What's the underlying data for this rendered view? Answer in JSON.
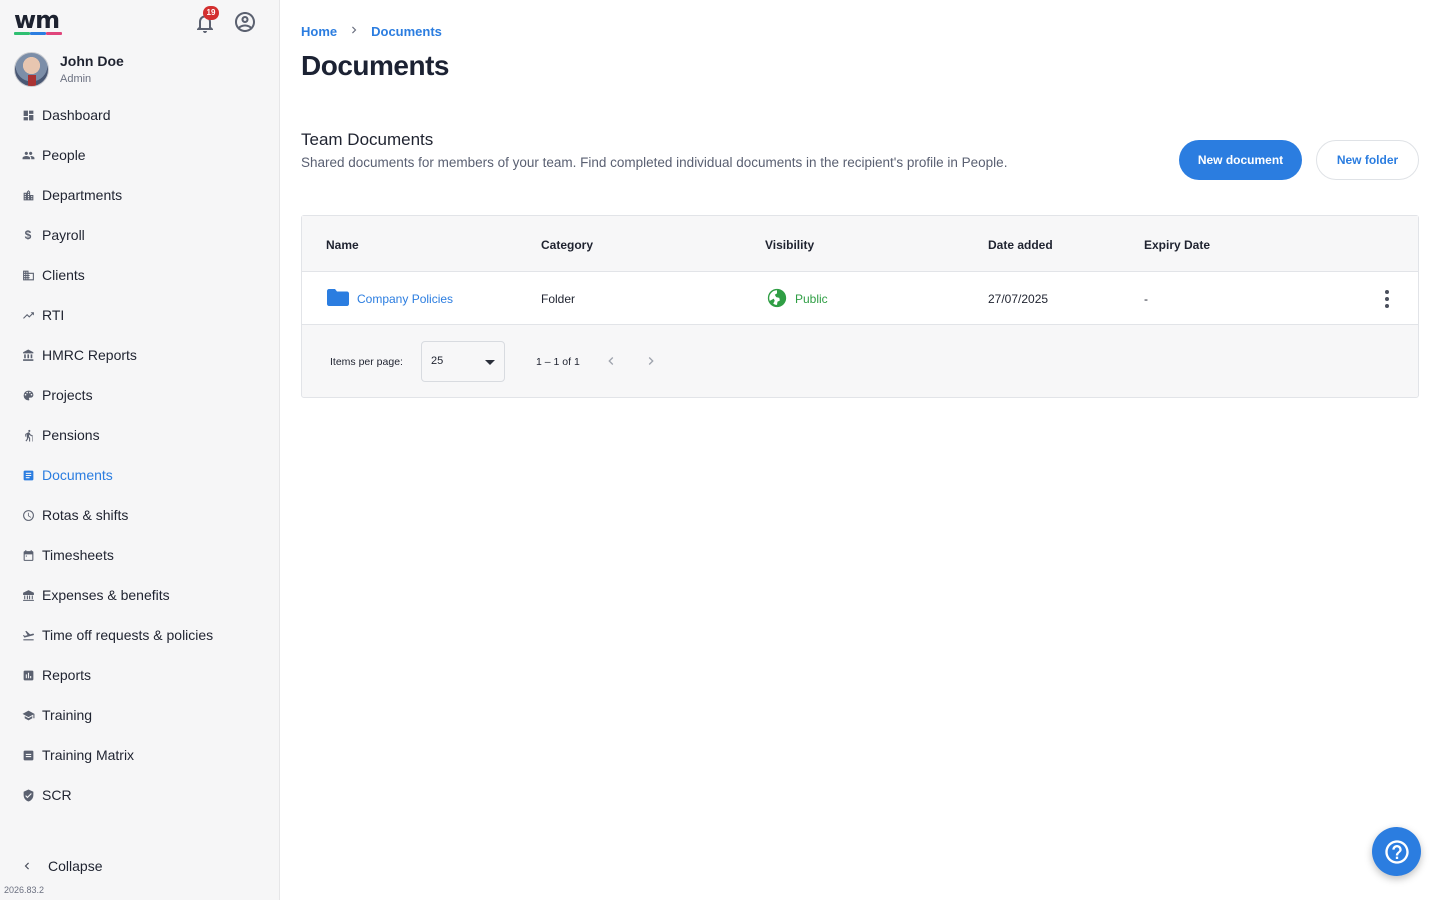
{
  "app": {
    "logo_text": "wm",
    "logo_colors": [
      "#2fbf71",
      "#2b7de0",
      "#e0457b"
    ],
    "notification_count": "19",
    "version": "2026.83.2"
  },
  "user": {
    "name": "John Doe",
    "role": "Admin"
  },
  "sidebar": {
    "items": [
      {
        "label": "Dashboard",
        "icon": "dashboard-icon",
        "active": false
      },
      {
        "label": "People",
        "icon": "people-icon",
        "active": false
      },
      {
        "label": "Departments",
        "icon": "building-icon",
        "active": false
      },
      {
        "label": "Payroll",
        "icon": "dollar-icon",
        "active": false
      },
      {
        "label": "Clients",
        "icon": "clients-icon",
        "active": false
      },
      {
        "label": "RTI",
        "icon": "trending-icon",
        "active": false
      },
      {
        "label": "HMRC Reports",
        "icon": "bank-icon",
        "active": false
      },
      {
        "label": "Projects",
        "icon": "palette-icon",
        "active": false
      },
      {
        "label": "Pensions",
        "icon": "elderly-icon",
        "active": false
      },
      {
        "label": "Documents",
        "icon": "document-icon",
        "active": true
      },
      {
        "label": "Rotas & shifts",
        "icon": "clock-icon",
        "active": false
      },
      {
        "label": "Timesheets",
        "icon": "calendar-icon",
        "active": false
      },
      {
        "label": "Expenses & benefits",
        "icon": "expenses-icon",
        "active": false
      },
      {
        "label": "Time off requests & policies",
        "icon": "plane-icon",
        "active": false
      },
      {
        "label": "Reports",
        "icon": "report-icon",
        "active": false
      },
      {
        "label": "Training",
        "icon": "school-icon",
        "active": false
      },
      {
        "label": "Training Matrix",
        "icon": "matrix-icon",
        "active": false
      },
      {
        "label": "SCR",
        "icon": "shield-icon",
        "active": false
      }
    ],
    "collapse_label": "Collapse"
  },
  "breadcrumb": {
    "home": "Home",
    "current": "Documents"
  },
  "page": {
    "title": "Documents",
    "section_title": "Team Documents",
    "section_subtitle": "Shared documents for members of your team. Find completed individual documents in the recipient's profile in People.",
    "new_document_label": "New document",
    "new_folder_label": "New folder"
  },
  "table": {
    "columns": [
      "Name",
      "Category",
      "Visibility",
      "Date added",
      "Expiry Date"
    ],
    "rows": [
      {
        "name": "Company Policies",
        "category": "Folder",
        "visibility": "Public",
        "date_added": "27/07/2025",
        "expiry": "-"
      }
    ]
  },
  "pager": {
    "label": "Items per page:",
    "page_size": "25",
    "range": "1 – 1 of 1"
  },
  "colors": {
    "accent": "#2b7de0",
    "public": "#2f9e44",
    "badge": "#d32f2f"
  }
}
